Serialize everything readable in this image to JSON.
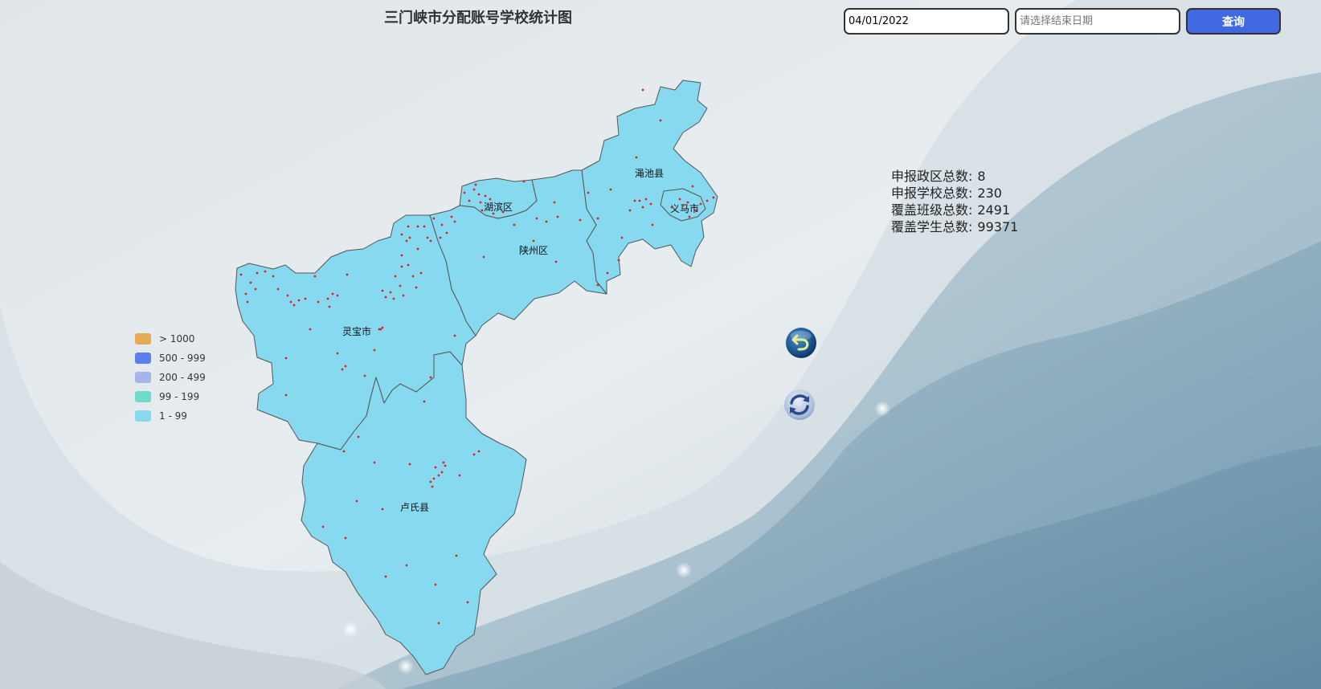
{
  "title": "三门峡市分配账号学校统计图",
  "query": {
    "start_date_value": "04/01/2022",
    "end_date_placeholder": "请选择结束日期",
    "button_label": "查询"
  },
  "stats": [
    {
      "label": "申报政区总数:",
      "value": "8"
    },
    {
      "label": "申报学校总数:",
      "value": "230"
    },
    {
      "label": "覆盖班级总数:",
      "value": "2491"
    },
    {
      "label": "覆盖学生总数:",
      "value": "99371"
    }
  ],
  "legend": [
    {
      "label": "> 1000",
      "color": "#e8ab55"
    },
    {
      "label": "500 - 999",
      "color": "#5b7ef0"
    },
    {
      "label": "200 - 499",
      "color": "#a5b4ea"
    },
    {
      "label": "99 - 199",
      "color": "#6fdccb"
    },
    {
      "label": "1 - 99",
      "color": "#86d9ef"
    }
  ],
  "regions": [
    {
      "name": "渑池县",
      "fill": "#86d9ef"
    },
    {
      "name": "湖滨区",
      "fill": "#86d9ef"
    },
    {
      "name": "义马市",
      "fill": "#86d9ef"
    },
    {
      "name": "陕州区",
      "fill": "#86d9ef"
    },
    {
      "name": "灵宝市",
      "fill": "#86d9ef"
    },
    {
      "name": "卢氏县",
      "fill": "#86d9ef"
    }
  ],
  "icons": {
    "back": "undo-arrow-icon",
    "refresh": "refresh-icon"
  },
  "colors": {
    "point": "#e02020",
    "border": "#555555",
    "button": "#4169e1"
  }
}
